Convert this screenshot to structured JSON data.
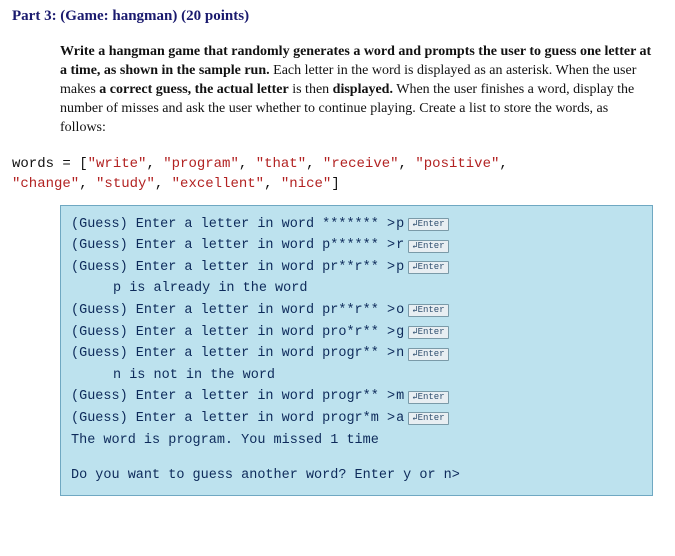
{
  "title": "Part 3: (Game: hangman) (20 points)",
  "description_segments": [
    {
      "text": "Write a hangman game that randomly generates a word and prompts the user to guess one letter at a time, as shown in the sample run.",
      "bold_prefix": "Write a hangman game that randomly generates a word and prompts the user to guess one letter at a time, as shown in the sample run."
    },
    {
      "text": " Each letter in the word is displayed as an asterisk. When the user makes "
    },
    {
      "text": "a correct guess, the actual letter",
      "bold": true
    },
    {
      "text": " is then "
    },
    {
      "text": "displayed.",
      "bold": true
    },
    {
      "text": " When the user finishes a word, display the number of misses and ask the user whether to continue playing. Create a list to store the words, as follows:"
    }
  ],
  "code": {
    "prefix": "words = [",
    "strings": [
      "\"write\"",
      "\"program\"",
      "\"that\"",
      "\"receive\"",
      "\"positive\"",
      "\"change\"",
      "\"study\"",
      "\"excellent\"",
      "\"nice\""
    ],
    "sep": ", ",
    "line2_prefix": "",
    "suffix": "]"
  },
  "enter_label": "↲Enter",
  "terminal": [
    {
      "type": "guess",
      "mask": "*******",
      "letter": "p"
    },
    {
      "type": "guess",
      "mask": "p******",
      "letter": "r"
    },
    {
      "type": "guess",
      "mask": "pr**r**",
      "letter": "p"
    },
    {
      "type": "msg",
      "text": "p is already in the word"
    },
    {
      "type": "guess",
      "mask": "pr**r**",
      "letter": "o"
    },
    {
      "type": "guess",
      "mask": "pro*r**",
      "letter": "g"
    },
    {
      "type": "guess",
      "mask": "progr**",
      "letter": "n"
    },
    {
      "type": "msg",
      "text": "n is not in the word"
    },
    {
      "type": "guess",
      "mask": "progr**",
      "letter": "m"
    },
    {
      "type": "guess",
      "mask": "progr*m",
      "letter": "a"
    },
    {
      "type": "plain",
      "text": "The word is program. You missed 1 time"
    },
    {
      "type": "blank"
    },
    {
      "type": "plain",
      "text": "Do you want to guess another word? Enter y or n>"
    }
  ],
  "guess_prefix": "(Guess) Enter a letter in word "
}
